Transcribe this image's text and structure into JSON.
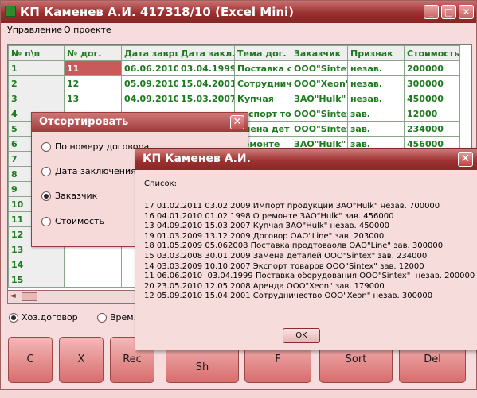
{
  "window": {
    "title": "КП Каменев А.И. 417318/10 (Excel Mini)",
    "buttons": {
      "minimize": "_",
      "maximize": "□",
      "close": "✕"
    }
  },
  "menu": {
    "items": [
      "Управление",
      "О проекте"
    ]
  },
  "grid": {
    "columns": [
      "№ п\\п",
      "№ дог.",
      "Дата заврш",
      "Дата закл.",
      "Тема дог.",
      "Заказчик",
      "Признак",
      "Стоимость"
    ],
    "rows": [
      [
        "1",
        "11",
        "06.06.2010",
        "03.04.1999",
        "Поставка о",
        "ООО\"Sintex",
        "незав.",
        "200000"
      ],
      [
        "2",
        "12",
        "05.09.2010",
        "15.04.2001",
        "Сотрудниче",
        "ООО\"Xeon\"",
        "незав.",
        "300000"
      ],
      [
        "3",
        "13",
        "04.09.2010",
        "15.03.2007",
        "Купчая",
        "ЗАО\"Hulk\"",
        "незав.",
        "450000"
      ],
      [
        "4",
        "",
        "",
        "",
        "экспорт тов",
        "ООО\"Sintex",
        "зав.",
        "12000"
      ],
      [
        "5",
        "",
        "",
        "",
        "амена дет",
        "ООО\"Sintex",
        "зав.",
        "234000"
      ],
      [
        "6",
        "",
        "",
        "",
        "ремонте",
        "ЗАО\"Hulk\"",
        "зав.",
        "456000"
      ],
      [
        "7",
        "",
        "",
        "",
        "",
        "",
        "",
        ""
      ],
      [
        "8",
        "",
        "",
        "",
        "",
        "",
        "",
        ""
      ],
      [
        "9",
        "",
        "",
        "",
        "",
        "",
        "",
        ""
      ],
      [
        "10",
        "",
        "",
        "",
        "",
        "",
        "",
        ""
      ],
      [
        "11",
        "",
        "",
        "",
        "",
        "",
        "",
        ""
      ],
      [
        "12",
        "",
        "",
        "",
        "",
        "",
        "",
        ""
      ],
      [
        "13",
        "",
        "",
        "",
        "",
        "",
        "",
        ""
      ],
      [
        "14",
        "",
        "",
        "",
        "",
        "",
        "",
        ""
      ],
      [
        "15",
        "",
        "",
        "",
        "",
        "",
        "",
        ""
      ]
    ]
  },
  "radios": {
    "contract_type": [
      {
        "label": "Хоз.договор",
        "checked": true
      },
      {
        "label": "Врем.",
        "checked": false
      }
    ]
  },
  "buttons": {
    "c": "C",
    "x": "X",
    "rec": "Rec",
    "sh": "Sh",
    "f": "F",
    "sort": "Sort",
    "del": "Del"
  },
  "sort_dialog": {
    "title": "Отсортировать",
    "options": [
      {
        "label": "По номеру договора",
        "checked": false
      },
      {
        "label": "Дата заключения",
        "checked": false
      },
      {
        "label": "Заказчик",
        "checked": true
      },
      {
        "label": "Стоимость",
        "checked": false
      }
    ]
  },
  "list_dialog": {
    "title": "КП Каменев А.И.",
    "caption": "Список:",
    "lines": [
      "17 01.02.2011 03.02.2009 Импорт продукции ЗАО\"Hulk\" незав. 700000",
      "16 04.01.2010 01.02.1998 О ремонте ЗАО\"Hulk\" зав. 456000",
      "13 04.09.2010 15.03.2007 Купчая ЗАО\"Hulk\" незав. 450000",
      "19 01.03.2009 13.12.2009 Договор ОАО\"Line\" зав. 203000",
      "18 01.05.2009 05.062008 Поставка продтоваолв ОАО\"Line\" зав. 300000",
      "15 03.03.2008 30.01.2009 Замена деталей ООО\"Sintex\" зав. 234000",
      "14 03.03.2009 10.10.2007 Экспорт товаров ООО\"Sintex\" зав. 12000",
      "11 06.06.2010  03.04.1999 Поставка оборудования ООО\"Sintex\"  незав. 200000",
      "20 23.05.2010 12.05.2008 Аренда ООО\"Xeon\" зав. 179000",
      "12 05.09.2010 15.04.2001 Сотрудничество ООО\"Xeon\" незав. 300000"
    ],
    "ok_label": "OK"
  },
  "colors": {
    "titlebar": "#9b2f2f",
    "grid_text": "#1e7a1e",
    "selected_cell": "#c85a5a",
    "background": "#f6dcdc"
  }
}
